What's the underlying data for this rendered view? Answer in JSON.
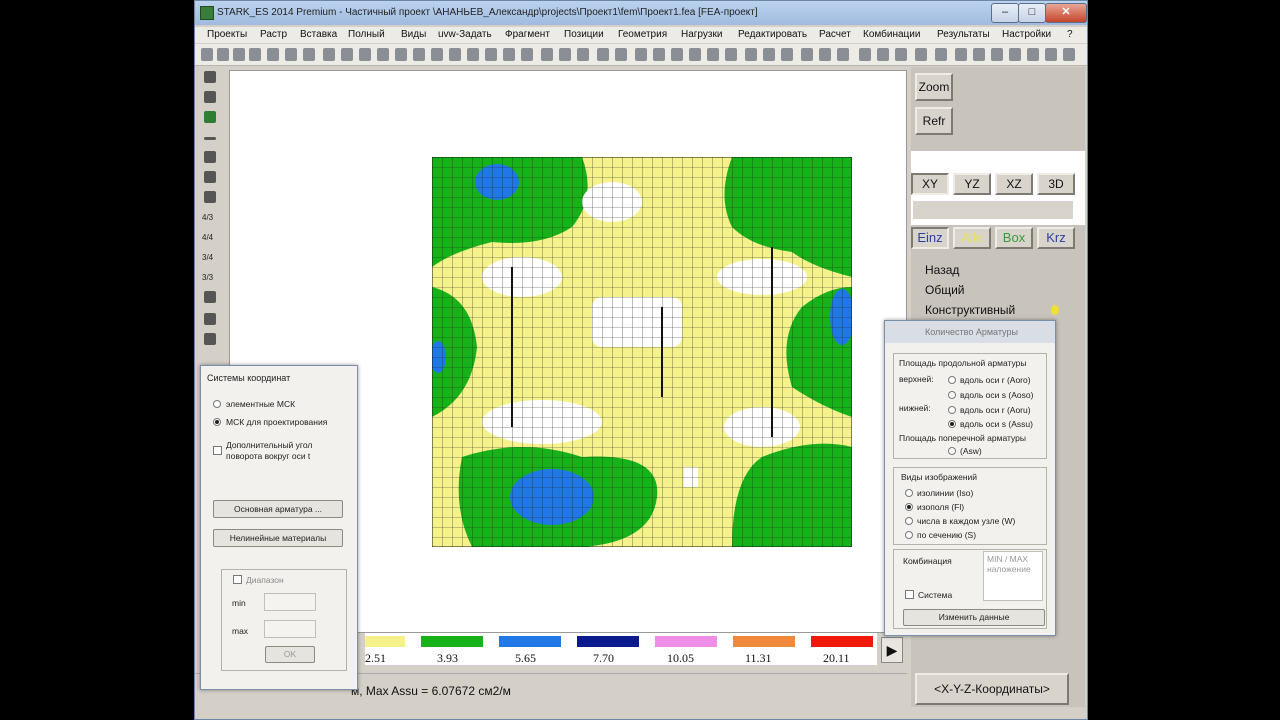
{
  "window": {
    "title": "STARK_ES 2014 Premium - Частичный проект \\АНАНЬЕВ_Александр\\projects\\Проект1\\fem\\Проект1.fea [FEA-проект]",
    "controls": {
      "minimize": "–",
      "maximize": "□",
      "close": "✕"
    }
  },
  "menu": {
    "items": [
      "Проекты",
      "Растр",
      "Вставка",
      "Полный",
      "Виды",
      "uvw-Задать",
      "Фрагмент",
      "Позиции",
      "Геометрия",
      "Нагрузки",
      "Редактировать",
      "Расчет",
      "Комбинации",
      "Результаты",
      "Настройки",
      "?"
    ]
  },
  "left_toolbar": {
    "labels": [
      "4/3",
      "4/4",
      "3/4",
      "3/3"
    ]
  },
  "legend": {
    "colors": [
      "#f5f28c",
      "#17b21a",
      "#1f78e6",
      "#0a1a8c",
      "#ef8ee6",
      "#ef8a3c",
      "#ef1a0c"
    ],
    "values": [
      "2.51",
      "3.93",
      "5.65",
      "7.70",
      "10.05",
      "11.31",
      "20.11"
    ]
  },
  "status": {
    "text": "м, Max Assu = 6.07672 см2/м"
  },
  "right_panel": {
    "zoom": "Zoom",
    "refr": "Refr",
    "views": [
      "XY",
      "YZ",
      "XZ",
      "3D"
    ],
    "modes": [
      "Einz",
      "Alle",
      "Box",
      "Krz"
    ],
    "mode_colors": [
      "#2a3ea8",
      "#e6e060",
      "#3a9a3a",
      "#2a3ea8"
    ],
    "nav": [
      "Назад",
      "Общий",
      "Конструктивный"
    ],
    "coords_button": "<X-Y-Z-Координаты>"
  },
  "coord_dialog": {
    "title": "Системы координат",
    "radio_element": "элементные МСК",
    "radio_design": "МСК для проектирования",
    "checkbox_angle": "Дополнительный угол поворота вокруг оси t",
    "btn_main_reinf": "Основная арматура ...",
    "btn_nonlinear": "Нелинейные материалы",
    "range_label": "Диапазон",
    "min_label": "min",
    "max_label": "max",
    "ok": "OK"
  },
  "reinf_dialog": {
    "title": "Количество Арматуры",
    "long_reinf_label": "Площадь продольной арматуры",
    "upper_label": "верхней:",
    "lower_label": "нижней:",
    "opt_aoro": "вдоль оси r (Aoro)",
    "opt_aoso": "вдоль оси s (Aoso)",
    "opt_aoru": "вдоль оси r (Aoru)",
    "opt_assu": "вдоль оси s (Assu)",
    "cross_reinf_label": "Площадь поперечной арматуры",
    "opt_asw": "(Asw)",
    "views_label": "Виды изображений",
    "view_isolines": "изолинии (Iso)",
    "view_isofields": "изополя (Fl)",
    "view_numbers": "числа в каждом узле (W)",
    "view_section": "по сечению (S)",
    "combination_label": "Комбинация",
    "minmax_text": "MIN / MAX наложение",
    "system_label": "Система",
    "change_data": "Изменить данные"
  }
}
